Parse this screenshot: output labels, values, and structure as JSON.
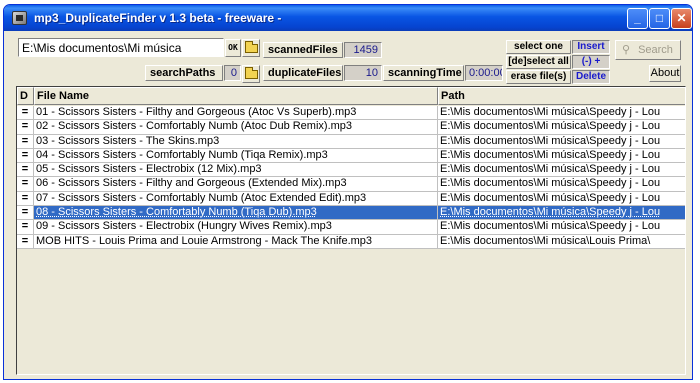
{
  "window": {
    "title": "mp3_DuplicateFinder  v 1.3 beta  - freeware -",
    "minimize_label": "_",
    "maximize_label": "□",
    "close_label": "✕"
  },
  "toolbar": {
    "path_value": "E:\\Mis documentos\\Mi música",
    "ok_label": "OK",
    "search_paths_label": "searchPaths",
    "search_paths_value": "0",
    "scanned_files_label": "scannedFiles",
    "scanned_files_value": "1459",
    "duplicate_files_label": "duplicateFiles",
    "duplicate_files_value": "10",
    "scanning_time_label": "scanningTime",
    "scanning_time_value": "0:00:00",
    "select_one_label": "select one",
    "insert_label": "Insert",
    "deselect_all_label": "[de]select all",
    "minus_plus_label": "(-)   +",
    "erase_files_label": "erase file(s)",
    "delete_label": "Delete",
    "search_label": "Search",
    "search_icon": "binoculars-icon",
    "about_label": "About"
  },
  "list": {
    "headers": {
      "d": "D",
      "name": "File Name",
      "path": "Path"
    },
    "rows": [
      {
        "d": "=",
        "name": "01 - Scissors Sisters - Filthy and Gorgeous (Atoc Vs Superb).mp3",
        "path": "E:\\Mis documentos\\Mi música\\Speedy j - Lou"
      },
      {
        "d": "=",
        "name": "02 - Scissors Sisters - Comfortably Numb (Atoc Dub Remix).mp3",
        "path": "E:\\Mis documentos\\Mi música\\Speedy j - Lou"
      },
      {
        "d": "=",
        "name": "03 - Scissors Sisters - The Skins.mp3",
        "path": "E:\\Mis documentos\\Mi música\\Speedy j - Lou"
      },
      {
        "d": "=",
        "name": "04 - Scissors Sisters - Comfortably Numb (Tiqa Remix).mp3",
        "path": "E:\\Mis documentos\\Mi música\\Speedy j - Lou"
      },
      {
        "d": "=",
        "name": "05 - Scissors Sisters - Electrobix (12 Mix).mp3",
        "path": "E:\\Mis documentos\\Mi música\\Speedy j - Lou"
      },
      {
        "d": "=",
        "name": "06 - Scissors Sisters - Filthy and Gorgeous (Extended Mix).mp3",
        "path": "E:\\Mis documentos\\Mi música\\Speedy j - Lou"
      },
      {
        "d": "=",
        "name": "07 - Scissors Sisters - Comfortably Numb (Atoc Extended Edit).mp3",
        "path": "E:\\Mis documentos\\Mi música\\Speedy j - Lou"
      },
      {
        "d": "=",
        "name": "08 - Scissors Sisters - Comfortably Numb (Tiqa Dub).mp3",
        "path": "E:\\Mis documentos\\Mi música\\Speedy j - Lou",
        "selected": true
      },
      {
        "d": "=",
        "name": "09 - Scissors Sisters - Electrobix (Hungry Wives Remix).mp3",
        "path": "E:\\Mis documentos\\Mi música\\Speedy j - Lou"
      },
      {
        "d": "=",
        "name": "MOB HITS - Louis Prima and Louie Armstrong - Mack The Knife.mp3",
        "path": "E:\\Mis documentos\\Mi música\\Louis Prima\\"
      }
    ]
  },
  "colors": {
    "titlebar": "#0955e4",
    "selection": "#316ac5",
    "value_text": "#1a1a8c",
    "action_blue": "#1a1acc"
  }
}
